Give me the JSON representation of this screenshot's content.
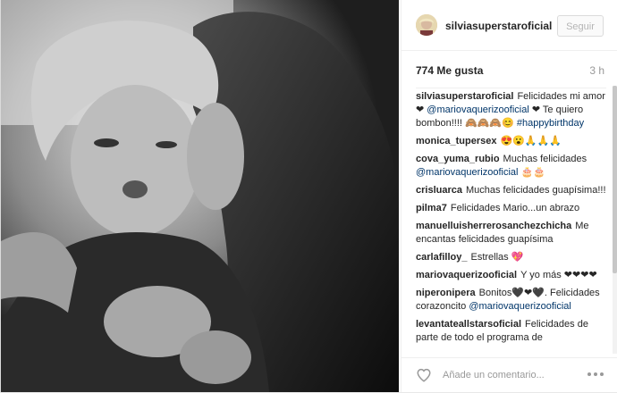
{
  "post": {
    "username": "silviasuperstaroficial",
    "follow_label": "Seguir",
    "likes": "774 Me gusta",
    "time": "3 h",
    "comment_placeholder": "Añade un comentario..."
  },
  "comments": [
    {
      "user": "silviasuperstaroficial",
      "parts": [
        "Felicidades mi amor ❤ ",
        "@mariovaquerizooficial",
        " ❤ Te quiero bombon!!!! 🙈🙈🙈😊 ",
        "#happybirthday"
      ]
    },
    {
      "user": "monica_tupersex",
      "text": "😍😮🙏🙏🙏"
    },
    {
      "user": "cova_yuma_rubio",
      "text": "Muchas felicidades",
      "mention": "@mariovaquerizooficial",
      "suffix": " 🎂🎂"
    },
    {
      "user": "crisluarca",
      "text": "Muchas felicidades guapísima!!!"
    },
    {
      "user": "pilma7",
      "text": "Felicidades Mario...un abrazo"
    },
    {
      "user": "manuelluisherrerosanchezchicha",
      "text": "Me encantas felicidades guapísima"
    },
    {
      "user": "carlafilloy_",
      "text": "Estrellas 💖"
    },
    {
      "user": "mariovaquerizooficial",
      "text": "Y yo más ❤❤❤❤"
    },
    {
      "user": "niperonipera",
      "text": "Bonitos🖤❤🖤. Felicidades corazoncito",
      "mention": "@mariovaquerizooficial"
    },
    {
      "user": "levantateallstarsoficial",
      "text": "Felicidades de parte de todo el programa de"
    }
  ],
  "colors": {
    "link": "#003569",
    "border": "#dbdbdb",
    "muted": "#999999"
  },
  "icons": {
    "like": "heart-outline-icon",
    "more": "ellipsis-icon"
  }
}
